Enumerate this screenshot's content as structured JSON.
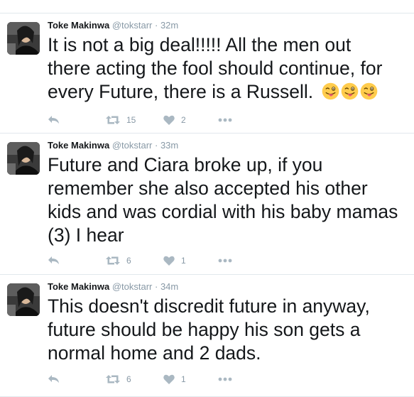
{
  "tweets": [
    {
      "name": "Toke Makinwa",
      "handle": "@tokstarr",
      "separator": "·",
      "time": "32m",
      "lines": [
        "It is not a big deal!!!!! All the men out",
        "there acting the fool should continue, for",
        "every Future, there is a Russell."
      ],
      "emoji": [
        "winking-face-with-tongue",
        "winking-face-with-tongue",
        "winking-face-with-tongue"
      ],
      "retweets": "15",
      "likes": "2"
    },
    {
      "name": "Toke Makinwa",
      "handle": "@tokstarr",
      "separator": "·",
      "time": "33m",
      "lines": [
        "Future and Ciara broke up, if you",
        "remember she also accepted his other",
        "kids and was cordial with his baby mamas",
        "(3) I hear"
      ],
      "retweets": "6",
      "likes": "1"
    },
    {
      "name": "Toke Makinwa",
      "handle": "@tokstarr",
      "separator": "·",
      "time": "34m",
      "lines": [
        "This doesn't discredit future in anyway,",
        "future should be happy his son gets a",
        "normal home and 2 dads."
      ],
      "retweets": "6",
      "likes": "1"
    }
  ],
  "colors": {
    "text": "#14171a",
    "muted": "#8899a6",
    "icon": "#aab8c2",
    "divider": "#e1e8ed"
  }
}
